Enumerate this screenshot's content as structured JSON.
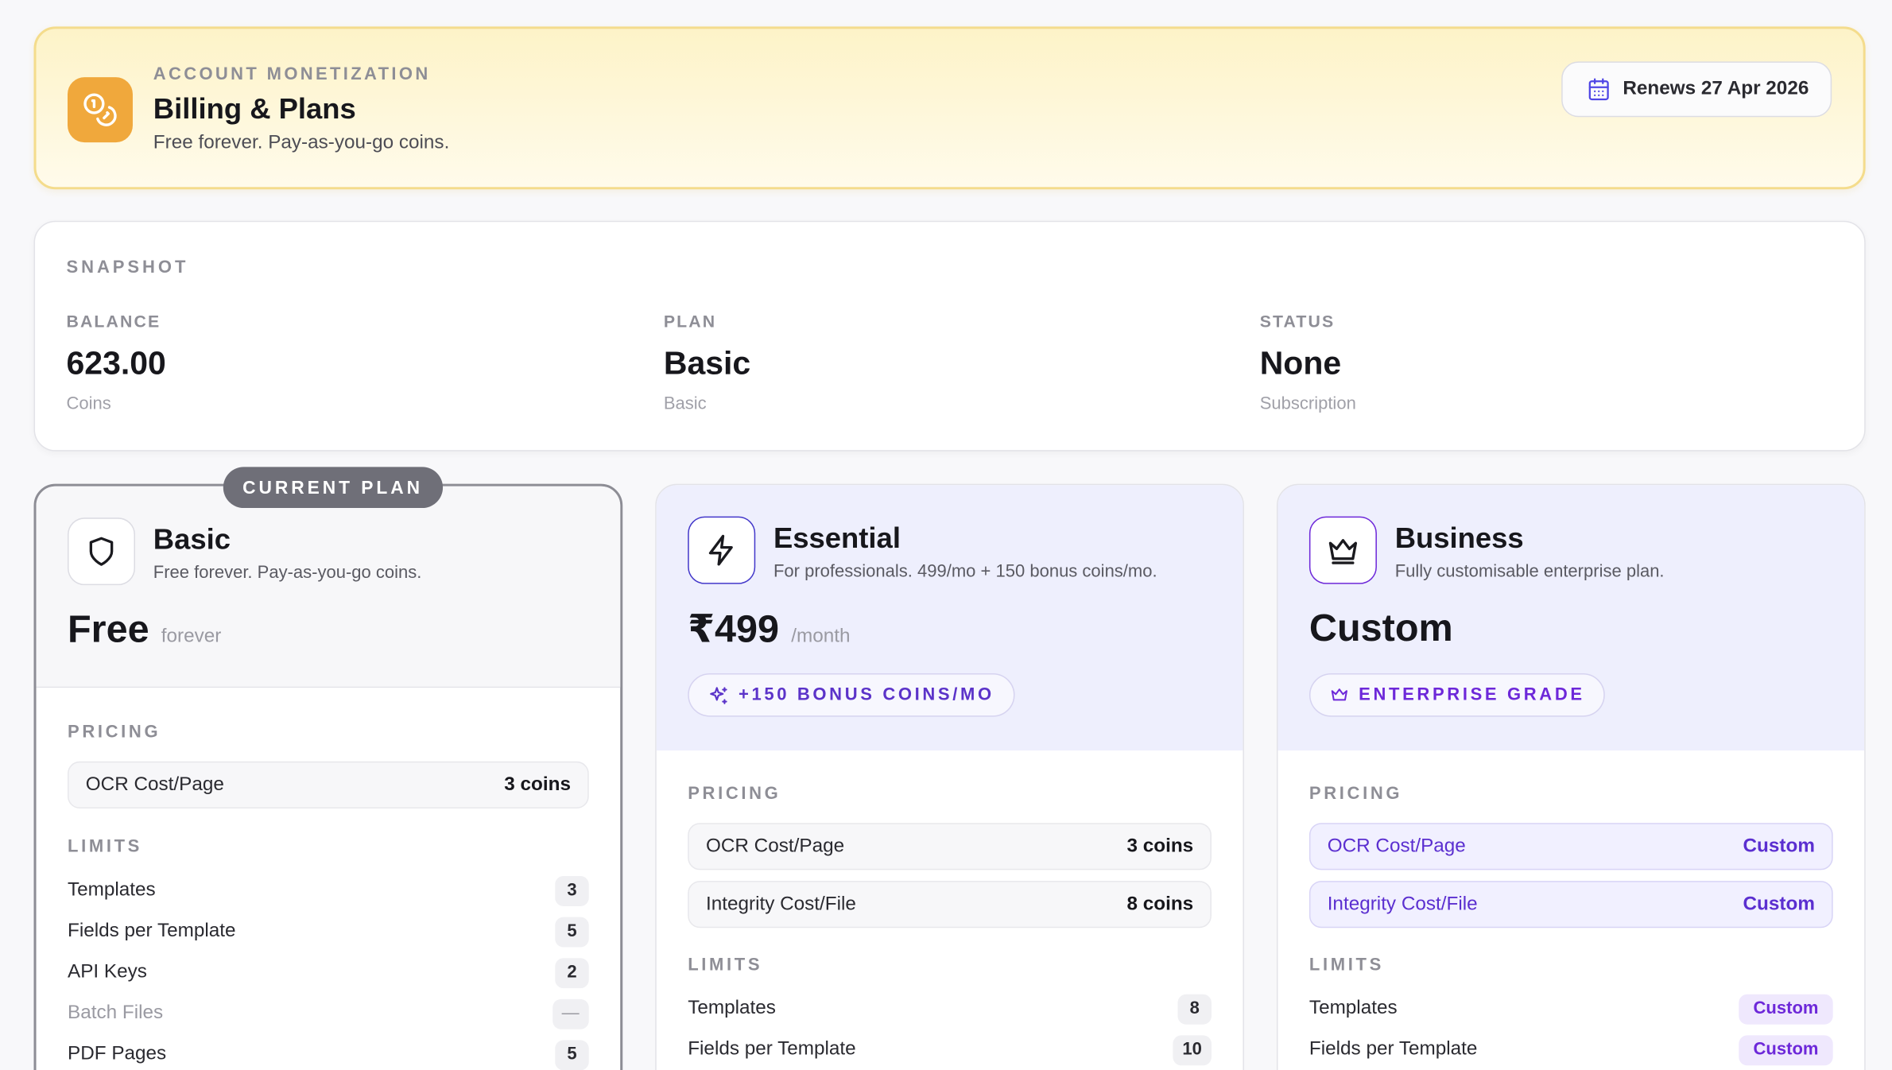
{
  "header": {
    "kicker": "ACCOUNT MONETIZATION",
    "title": "Billing & Plans",
    "subtitle": "Free forever. Pay-as-you-go coins.",
    "renew_label": "Renews 27 Apr 2026",
    "icon": "coins-icon",
    "accent": "#f0a83c"
  },
  "snapshot": {
    "kicker": "SNAPSHOT",
    "balance": {
      "label": "BALANCE",
      "value": "623.00",
      "sub": "Coins"
    },
    "plan": {
      "label": "PLAN",
      "value": "Basic",
      "sub": "Basic"
    },
    "status": {
      "label": "STATUS",
      "value": "None",
      "sub": "Subscription"
    }
  },
  "plans": [
    {
      "badge": "CURRENT PLAN",
      "name": "Basic",
      "desc": "Free forever. Pay-as-you-go coins.",
      "price": "Free",
      "unit": "forever",
      "icon": "shield-icon",
      "pricing_label": "PRICING",
      "pricing": [
        {
          "label": "OCR Cost/Page",
          "value": "3 coins"
        }
      ],
      "limits_label": "LIMITS",
      "limits": [
        {
          "label": "Templates",
          "value": "3"
        },
        {
          "label": "Fields per Template",
          "value": "5"
        },
        {
          "label": "API Keys",
          "value": "2"
        },
        {
          "label": "Batch Files",
          "value": "—"
        },
        {
          "label": "PDF Pages",
          "value": "5"
        }
      ]
    },
    {
      "name": "Essential",
      "desc": "For professionals. 499/mo + 150 bonus coins/mo.",
      "price": "₹499",
      "unit": "/month",
      "pill": "+150 BONUS COINS/MO",
      "icon": "lightning-icon",
      "pricing_label": "PRICING",
      "pricing": [
        {
          "label": "OCR Cost/Page",
          "value": "3 coins"
        },
        {
          "label": "Integrity Cost/File",
          "value": "8 coins"
        }
      ],
      "limits_label": "LIMITS",
      "limits": [
        {
          "label": "Templates",
          "value": "8"
        },
        {
          "label": "Fields per Template",
          "value": "10"
        }
      ]
    },
    {
      "name": "Business",
      "desc": "Fully customisable enterprise plan.",
      "price": "Custom",
      "pill": "ENTERPRISE GRADE",
      "icon": "crown-icon",
      "pricing_label": "PRICING",
      "pricing": [
        {
          "label": "OCR Cost/Page",
          "value": "Custom"
        },
        {
          "label": "Integrity Cost/File",
          "value": "Custom"
        }
      ],
      "limits_label": "LIMITS",
      "limits": [
        {
          "label": "Templates",
          "value": "Custom"
        },
        {
          "label": "Fields per Template",
          "value": "Custom"
        }
      ]
    }
  ]
}
